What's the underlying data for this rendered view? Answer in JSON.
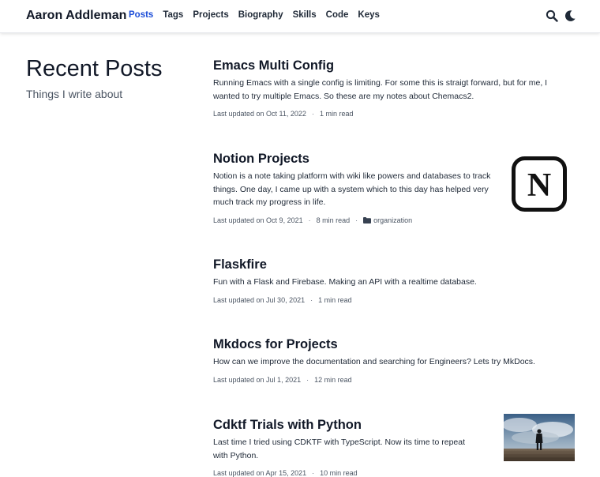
{
  "header": {
    "brand": "Aaron Addleman",
    "nav": [
      {
        "label": "Posts",
        "active": true
      },
      {
        "label": "Tags",
        "active": false
      },
      {
        "label": "Projects",
        "active": false
      },
      {
        "label": "Biography",
        "active": false
      },
      {
        "label": "Skills",
        "active": false
      },
      {
        "label": "Code",
        "active": false
      },
      {
        "label": "Keys",
        "active": false
      }
    ],
    "search_icon": "search-icon",
    "theme_icon": "moon-icon",
    "accent_color": "#1d4ed8"
  },
  "aside": {
    "title": "Recent Posts",
    "subtitle": "Things I write about"
  },
  "posts": [
    {
      "title": "Emacs Multi Config",
      "summary": "Running Emacs with a single config is limiting. For some this is straigt forward, but for me, I wanted to try multiple Emacs. So these are my notes about Chemacs2.",
      "updated": "Last updated on Oct 11, 2022",
      "read_time": "1 min read"
    },
    {
      "title": "Notion Projects",
      "summary": "Notion is a note taking platform with wiki like powers and databases to track things. One day, I came up with a system which to this day has helped very much track my progress in life.",
      "updated": "Last updated on Oct 9, 2021",
      "read_time": "8 min read",
      "category": "organization",
      "thumb_letter": "N"
    },
    {
      "title": "Flaskfire",
      "summary": "Fun with a Flask and Firebase. Making an API with a realtime database.",
      "updated": "Last updated on Jul 30, 2021",
      "read_time": "1 min read"
    },
    {
      "title": "Mkdocs for Projects",
      "summary": "How can we improve the documentation and searching for Engineers? Lets try MkDocs.",
      "updated": "Last updated on Jul 1, 2021",
      "read_time": "12 min read"
    },
    {
      "title": "Cdktf Trials with Python",
      "summary": "Last time I tried using CDKTF with TypeScript. Now its time to repeat with Python.",
      "updated": "Last updated on Apr 15, 2021",
      "read_time": "10 min read"
    }
  ]
}
